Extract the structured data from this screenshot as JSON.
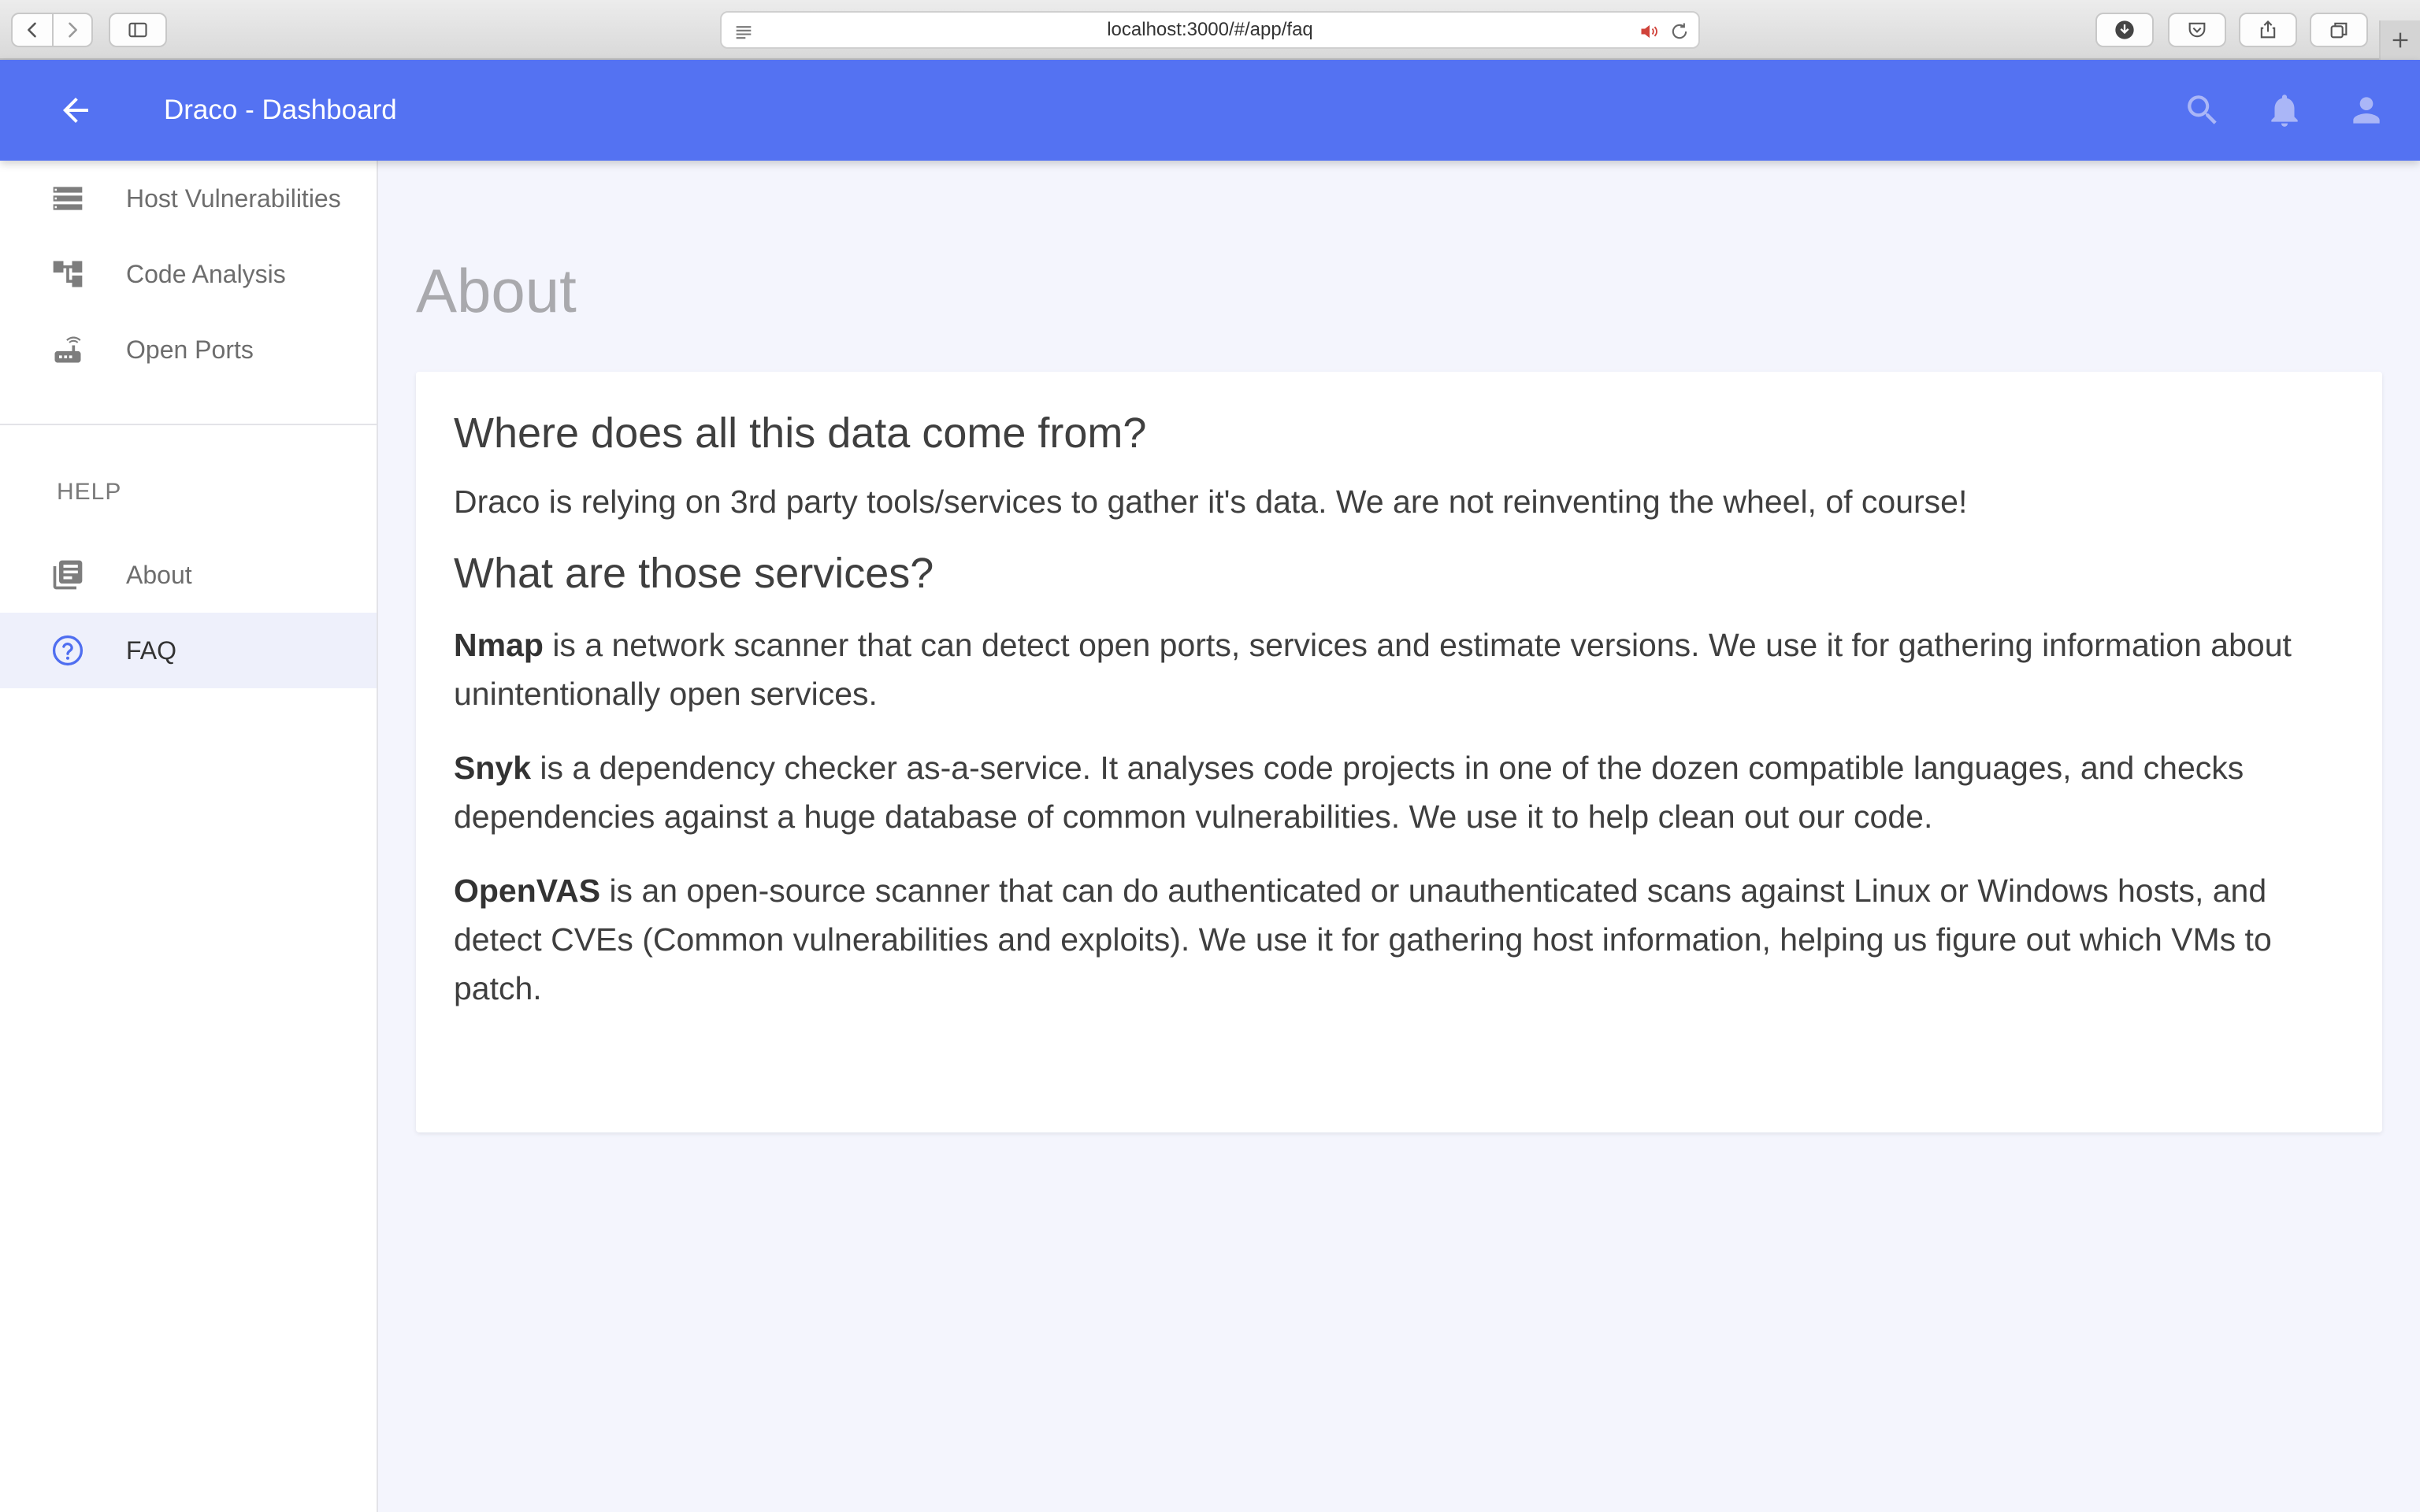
{
  "browser": {
    "url": "localhost:3000/#/app/faq"
  },
  "app_bar": {
    "title": "Draco - Dashboard",
    "accent_color": "#5472f2"
  },
  "sidebar": {
    "items": [
      {
        "label": "Host Vulnerabilities",
        "icon": "list-icon"
      },
      {
        "label": "Code Analysis",
        "icon": "tree-icon"
      },
      {
        "label": "Open Ports",
        "icon": "router-icon"
      }
    ],
    "help_section": {
      "label": "HELP",
      "items": [
        {
          "label": "About",
          "icon": "library-books-icon"
        },
        {
          "label": "FAQ",
          "icon": "help-circle-icon",
          "active": true
        }
      ]
    }
  },
  "main": {
    "page_title": "About",
    "card": {
      "heading1": "Where does all this data come from?",
      "para1": "Draco is relying on 3rd party tools/services to gather it's data. We are not reinventing the wheel, of course!",
      "heading2": "What are those services?",
      "services": [
        {
          "name": "Nmap",
          "text": " is a network scanner that can detect open ports, services and estimate versions. We use it for gathering information about unintentionally open services."
        },
        {
          "name": "Snyk",
          "text": " is a dependency checker as-a-service. It analyses code projects in one of the dozen compatible languages, and checks dependencies against a huge database of common vulnerabilities. We use it to help clean out our code."
        },
        {
          "name": "OpenVAS",
          "text": " is an open-source scanner that can do authenticated or unauthenticated scans against Linux or Windows hosts, and detect CVEs (Common vulnerabilities and exploits). We use it for gathering host information, helping us figure out which VMs to patch."
        }
      ]
    }
  }
}
